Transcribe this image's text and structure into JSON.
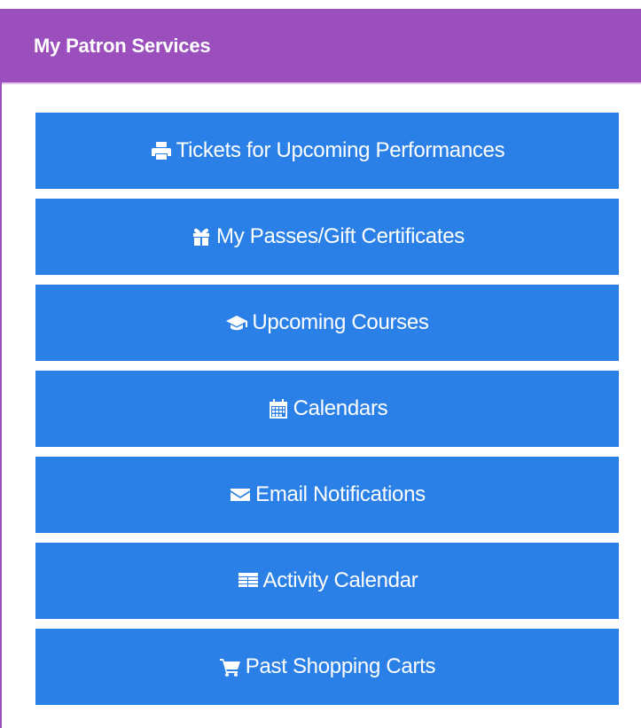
{
  "panel": {
    "title": "My Patron Services",
    "buttons": [
      {
        "label": "Tickets for Upcoming Performances",
        "icon": "print-icon"
      },
      {
        "label": "My Passes/Gift Certificates",
        "icon": "gift-icon"
      },
      {
        "label": "Upcoming Courses",
        "icon": "graduation-cap-icon"
      },
      {
        "label": "Calendars",
        "icon": "calendar-icon"
      },
      {
        "label": "Email Notifications",
        "icon": "envelope-icon"
      },
      {
        "label": "Activity Calendar",
        "icon": "list-calendar-icon"
      },
      {
        "label": "Past Shopping Carts",
        "icon": "shopping-cart-icon"
      }
    ]
  },
  "colors": {
    "header": "#9b4fbd",
    "button": "#2a80e6",
    "text": "#ffffff"
  }
}
